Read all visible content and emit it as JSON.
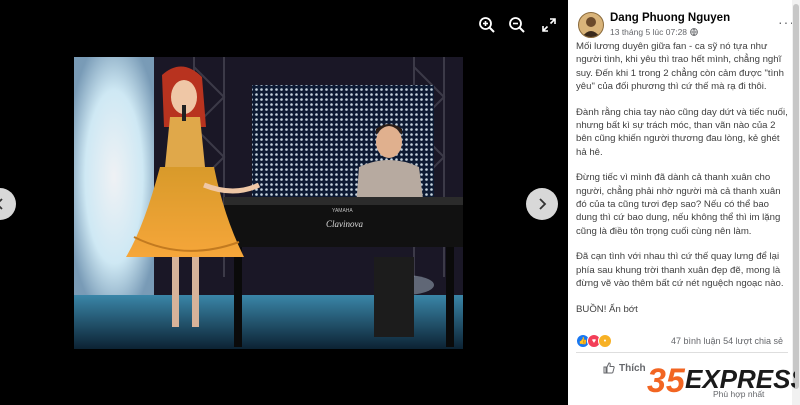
{
  "viewer": {
    "zoom_in_icon": "zoom-in-icon",
    "zoom_out_icon": "zoom-out-icon",
    "fullscreen_icon": "expand-icon",
    "piano_brand": "YAMAHA",
    "piano_model": "Clavinova"
  },
  "post": {
    "author": "Dang Phuong Nguyen",
    "timestamp": "13 tháng 5 lúc 07:28",
    "paragraphs": [
      "Mối lương duyên giữa fan - ca sỹ nó tựa như người tình, khi yêu thì trao hết mình, chẳng nghĩ suy. Đến khi 1 trong 2 chẳng còn cảm được \"tình yêu\" của đối phương thì cứ thế mà rạ đi thôi.",
      "Đành rằng chia tay nào cũng day dứt và tiếc nuối, nhưng bất kì sự trách móc, than vãn nào của 2 bên cũng khiến người thương đau lòng, kẻ ghét hả hê.",
      "Đừng tiếc vì mình đã dành cả thanh xuân cho người, chẳng phải nhờ người mà cả thanh xuân đó của ta cũng tươi đẹp sao? Nếu có thể bao dung thì cứ bao dung, nếu không thể thì im lặng cũng là điều tôn trọng cuối cùng nên làm.",
      "Đã cạn tình với nhau thì cứ thế quay lưng để lại phía sau khung trời thanh xuân đẹp đẽ, mong là đừng vẽ vào thêm bất cứ nét nguệch ngoạc nào.",
      "BUỒN! Ẩn bớt"
    ],
    "comments": "47 bình luận",
    "shares": "54 lượt chia sẻ",
    "like_label": "Thích",
    "sort_label": "Phù hợp nhất"
  },
  "watermark": {
    "brand_number": "35",
    "brand_text": "EXPRESS"
  },
  "colors": {
    "like_blue": "#1877f2",
    "love_red": "#f33e58",
    "haha_yellow": "#f7b125",
    "logo_orange": "#f26522"
  }
}
